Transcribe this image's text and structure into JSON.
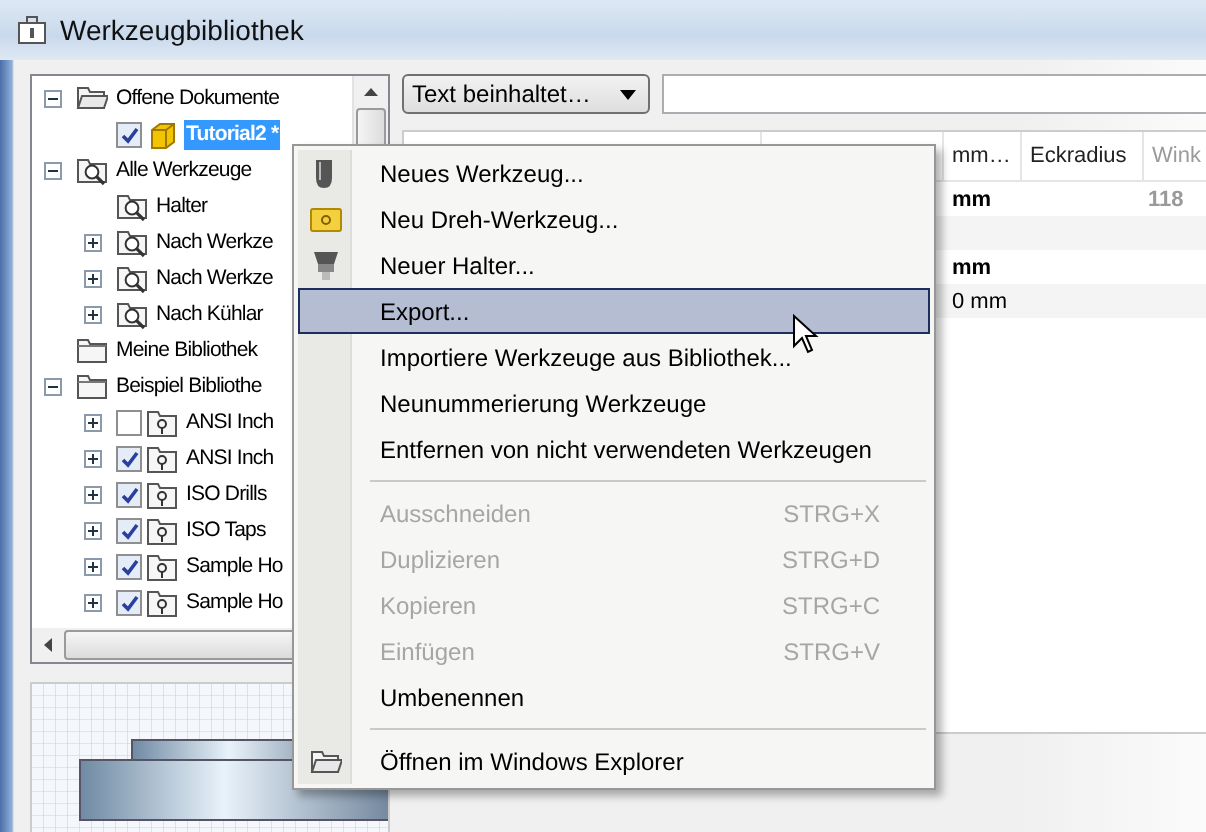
{
  "window": {
    "title": "Werkzeugbibliothek"
  },
  "tree": [
    {
      "label": "Offene Dokumente",
      "kind": "open-folder",
      "expanded": true,
      "selected": false,
      "children": [
        {
          "label": "Tutorial2 *",
          "kind": "document",
          "checked": true,
          "selected": true
        }
      ]
    },
    {
      "label": "Alle Werkzeuge",
      "kind": "search",
      "expanded": true,
      "selected": false,
      "children": [
        {
          "label": "Halter",
          "kind": "search",
          "selected": false
        },
        {
          "label": "Nach Werkze",
          "kind": "search",
          "expanded": false,
          "selected": false
        },
        {
          "label": "Nach Werkze",
          "kind": "search",
          "expanded": false,
          "selected": false
        },
        {
          "label": "Nach Kühlar",
          "kind": "search",
          "expanded": false,
          "selected": false
        }
      ]
    },
    {
      "label": "Meine Bibliothek",
      "kind": "folder",
      "selected": false
    },
    {
      "label": "Beispiel Bibliothe",
      "kind": "folder",
      "expanded": true,
      "selected": false,
      "children": [
        {
          "label": "ANSI Inch",
          "kind": "library",
          "expanded": false,
          "checked": false,
          "selected": false
        },
        {
          "label": "ANSI Inch",
          "kind": "library",
          "expanded": false,
          "checked": true,
          "selected": false
        },
        {
          "label": "ISO Drills",
          "kind": "library",
          "expanded": false,
          "checked": true,
          "selected": false
        },
        {
          "label": "ISO Taps",
          "kind": "library",
          "expanded": false,
          "checked": true,
          "selected": false
        },
        {
          "label": "Sample Ho",
          "kind": "library",
          "expanded": false,
          "checked": true,
          "selected": false
        },
        {
          "label": "Sample Ho",
          "kind": "library",
          "expanded": false,
          "checked": true,
          "selected": false
        }
      ]
    }
  ],
  "filter": {
    "value": "Text beinhaltet…"
  },
  "table": {
    "columns": [
      "mm…",
      "Eckradius",
      "Wink"
    ],
    "rows": [
      [
        "mm",
        "",
        "118"
      ],
      [
        "",
        "",
        ""
      ],
      [
        "mm",
        "",
        ""
      ],
      [
        "0 mm",
        "",
        ""
      ]
    ]
  },
  "context_menu": [
    {
      "kind": "item",
      "label": "Neues Werkzeug...",
      "selected": false,
      "disabled": false
    },
    {
      "kind": "item",
      "label": "Neu Dreh-Werkzeug...",
      "selected": false,
      "disabled": false
    },
    {
      "kind": "item",
      "label": "Neuer Halter...",
      "selected": false,
      "disabled": false
    },
    {
      "kind": "item",
      "label": "Export...",
      "selected": true,
      "disabled": false
    },
    {
      "kind": "item",
      "label": "Importiere Werkzeuge aus Bibliothek...",
      "selected": false,
      "disabled": false
    },
    {
      "kind": "item",
      "label": "Neunummerierung Werkzeuge",
      "selected": false,
      "disabled": false
    },
    {
      "kind": "item",
      "label": "Entfernen von nicht verwendeten Werkzeugen",
      "selected": false,
      "disabled": false
    },
    {
      "kind": "separator"
    },
    {
      "kind": "item",
      "label": "Ausschneiden",
      "shortcut": "STRG+X",
      "selected": false,
      "disabled": true
    },
    {
      "kind": "item",
      "label": "Duplizieren",
      "shortcut": "STRG+D",
      "selected": false,
      "disabled": true
    },
    {
      "kind": "item",
      "label": "Kopieren",
      "shortcut": "STRG+C",
      "selected": false,
      "disabled": true
    },
    {
      "kind": "item",
      "label": "Einfügen",
      "shortcut": "STRG+V",
      "selected": false,
      "disabled": true
    },
    {
      "kind": "item",
      "label": "Umbenennen",
      "selected": false,
      "disabled": false
    },
    {
      "kind": "separator"
    },
    {
      "kind": "item",
      "label": "Öffnen im Windows Explorer",
      "selected": false,
      "disabled": false
    }
  ]
}
